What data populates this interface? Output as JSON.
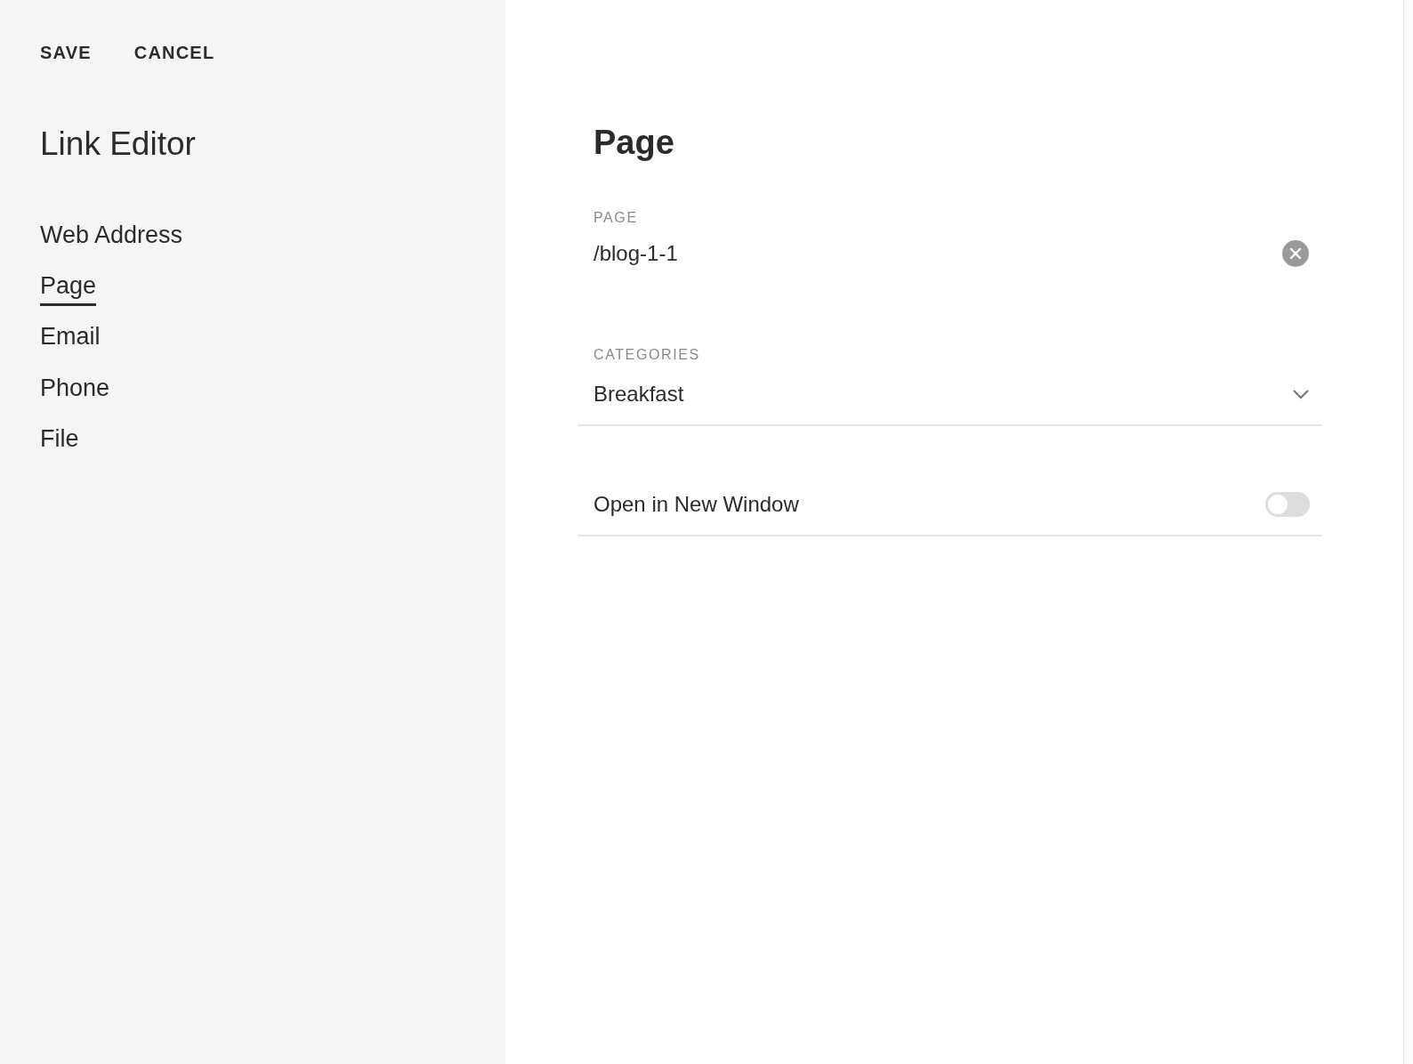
{
  "actions": [
    {
      "label": "SAVE"
    },
    {
      "label": "CANCEL"
    }
  ],
  "sidebar": {
    "title": "Link Editor",
    "items": [
      {
        "label": "Web Address",
        "selected": false
      },
      {
        "label": "Page",
        "selected": true
      },
      {
        "label": "Email",
        "selected": false
      },
      {
        "label": "Phone",
        "selected": false
      },
      {
        "label": "File",
        "selected": false
      }
    ]
  },
  "panel": {
    "title": "Page",
    "fields": [
      {
        "kind": "text",
        "label": "PAGE",
        "value": "/blog-1-1"
      },
      {
        "kind": "select",
        "label": "CATEGORIES",
        "value": "Breakfast"
      },
      {
        "kind": "toggle",
        "label": "Open in New Window",
        "on": false
      }
    ]
  }
}
